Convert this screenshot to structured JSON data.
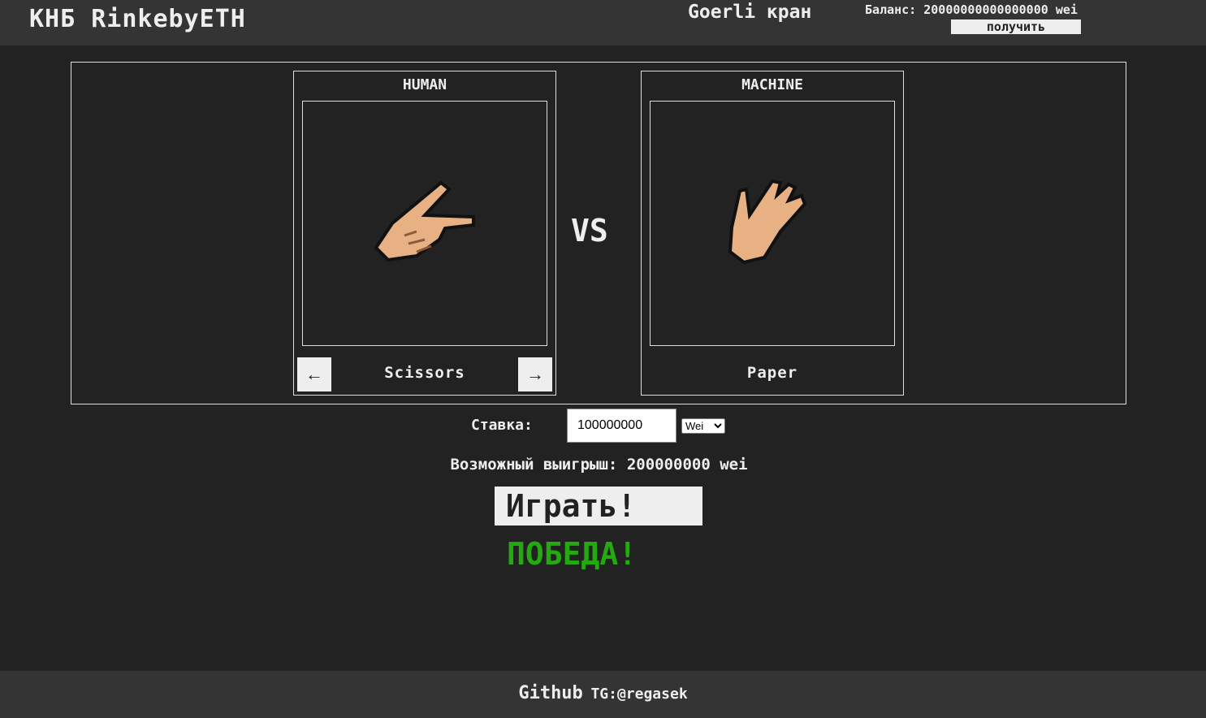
{
  "header": {
    "logo": "КНБ RinkebyETH",
    "faucet": "Goerli кран",
    "balance_label": "Баланс:",
    "balance_value": "20000000000000000",
    "balance_unit": "wei",
    "get_button": "получить"
  },
  "game": {
    "human": {
      "title": "HUMAN",
      "choice": "Scissors",
      "prev": "←",
      "next": "→",
      "icon": "scissors-hand-icon"
    },
    "vs": "VS",
    "machine": {
      "title": "MACHINE",
      "choice": "Paper",
      "icon": "paper-hand-icon"
    }
  },
  "bet": {
    "label": "Ставка:",
    "value": "100000000",
    "unit": "Wei"
  },
  "winnings": {
    "label": "Возможный выигрыш:",
    "value": "200000000",
    "unit": "wei"
  },
  "play_button": "Играть!",
  "result": {
    "text": "ПОБЕДА!",
    "color": "#22aa0f"
  },
  "footer": {
    "github": "Github",
    "tg": "TG:@regasek"
  }
}
